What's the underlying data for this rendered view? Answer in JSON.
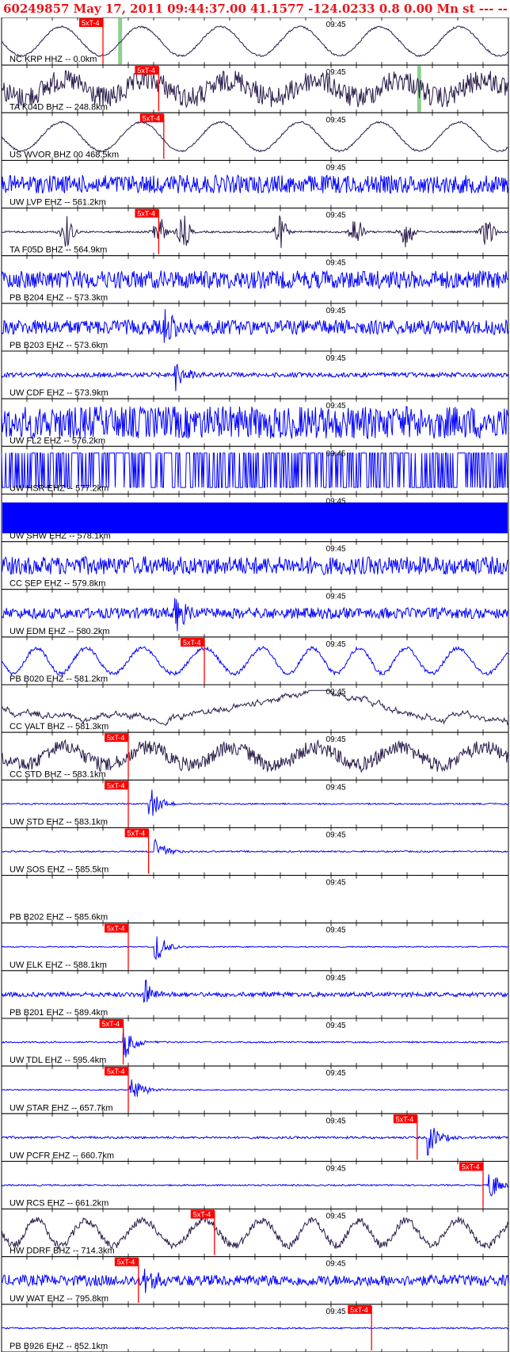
{
  "header": {
    "event_id": "60249857",
    "datetime": "May 17, 2011 09:44:37.00",
    "location": "41.1577 -124.0233",
    "depth": "0.8",
    "magnitude": "0.00",
    "mag_type": "Mn",
    "extra": "st --- -- --",
    "flag": "-1"
  },
  "colors": {
    "header": "#e8141a",
    "trace_blue": "#0000ff",
    "trace_dark": "#2a1a4a",
    "pick_box": "#ff0000",
    "pick_line": "#ff0000",
    "green_mark": "#8fcf8f",
    "tick": "#000000"
  },
  "chart_data": {
    "type": "line",
    "time_marker": "09:45",
    "pick_label": "5xT-4",
    "traces": [
      {
        "label": "NC KRP HHZ -- 0.0km",
        "style": "sine",
        "color": "dark",
        "pick": 0.2,
        "noise": 0.1,
        "green": 0.23
      },
      {
        "label": "TA K04D BHZ -- 248.8km",
        "style": "noisy_wave",
        "color": "dark",
        "pick": 0.31,
        "noise": 0.6,
        "green": 0.82
      },
      {
        "label": "US WVOR BHZ 00 468.5km",
        "style": "sine",
        "color": "dark",
        "pick": 0.32,
        "noise": 0.1
      },
      {
        "label": "UW LVP EHZ -- 561.2km",
        "style": "noise",
        "color": "blue",
        "noise": 1.0
      },
      {
        "label": "TA F05D BHZ -- 564.9km",
        "style": "bursts",
        "color": "dark",
        "pick": 0.31,
        "noise": 0.3
      },
      {
        "label": "PB B204 EHZ -- 573.3km",
        "style": "noise",
        "color": "blue",
        "noise": 1.0
      },
      {
        "label": "PB B203 EHZ -- 573.6km",
        "style": "noise",
        "color": "blue",
        "noise": 0.8,
        "burst": 0.32
      },
      {
        "label": "UW CDF EHZ -- 573.9km",
        "style": "noise",
        "color": "blue",
        "noise": 0.25,
        "burst": 0.34
      },
      {
        "label": "UW FL2 EHZ -- 576.2km",
        "style": "noise",
        "color": "blue",
        "noise": 1.8
      },
      {
        "label": "UW HSR EHZ -- 577.2km",
        "style": "clipped",
        "color": "blue",
        "noise": 1.0
      },
      {
        "label": "UW SHW EHZ -- 578.1km",
        "style": "block",
        "color": "blue",
        "noise": 1.0
      },
      {
        "label": "CC SEP EHZ -- 579.8km",
        "style": "noise",
        "color": "blue",
        "noise": 1.0
      },
      {
        "label": "UW EDM EHZ -- 580.2km",
        "style": "noise",
        "color": "blue",
        "noise": 0.6,
        "burst": 0.34
      },
      {
        "label": "PB B020 EHZ -- 581.2km",
        "style": "wavy",
        "color": "blue",
        "pick": 0.4,
        "noise": 0.2
      },
      {
        "label": "CC VALT BHZ -- 581.3km",
        "style": "drift",
        "color": "dark",
        "noise": 0.2
      },
      {
        "label": "CC STD BHZ -- 583.1km",
        "style": "noisy_wave",
        "color": "dark",
        "pick": 0.25,
        "noise": 0.4
      },
      {
        "label": "UW STD EHZ -- 583.1km",
        "style": "event",
        "color": "blue",
        "pick": 0.25,
        "noise": 0.08,
        "burst": 0.29
      },
      {
        "label": "UW SOS EHZ -- 585.5km",
        "style": "event",
        "color": "blue",
        "pick": 0.29,
        "noise": 0.08,
        "burst": 0.3
      },
      {
        "label": "PB B202 EHZ -- 585.6km",
        "style": "empty",
        "color": "blue",
        "noise": 0.0
      },
      {
        "label": "UW ELK EHZ -- 588.1km",
        "style": "event",
        "color": "blue",
        "pick": 0.25,
        "noise": 0.06,
        "burst": 0.3
      },
      {
        "label": "PB B201 EHZ -- 589.4km",
        "style": "event",
        "color": "blue",
        "noise": 0.25,
        "burst": 0.28
      },
      {
        "label": "UW TDL EHZ -- 595.4km",
        "style": "event",
        "color": "blue",
        "pick": 0.24,
        "noise": 0.08,
        "burst": 0.24
      },
      {
        "label": "UW STAR EHZ -- 657.7km",
        "style": "event",
        "color": "blue",
        "pick": 0.25,
        "noise": 0.06,
        "burst": 0.25
      },
      {
        "label": "UW PCFR EHZ -- 660.7km",
        "style": "event",
        "color": "blue",
        "pick": 0.82,
        "noise": 0.12,
        "burst": 0.84
      },
      {
        "label": "UW RCS EHZ -- 661.2km",
        "style": "event",
        "color": "blue",
        "pick": 0.95,
        "noise": 0.08,
        "burst": 0.96
      },
      {
        "label": "HW DDRF BHZ -- 714.3km",
        "style": "wavy",
        "color": "dark",
        "pick": 0.42,
        "noise": 0.4
      },
      {
        "label": "UW WAT EHZ -- 795.8km",
        "style": "noise",
        "color": "blue",
        "pick": 0.27,
        "noise": 0.6,
        "burst": 0.28
      },
      {
        "label": "PB B926 EHZ -- 852.1km",
        "style": "event",
        "color": "blue",
        "pick": 0.73,
        "noise": 0.08
      }
    ]
  }
}
